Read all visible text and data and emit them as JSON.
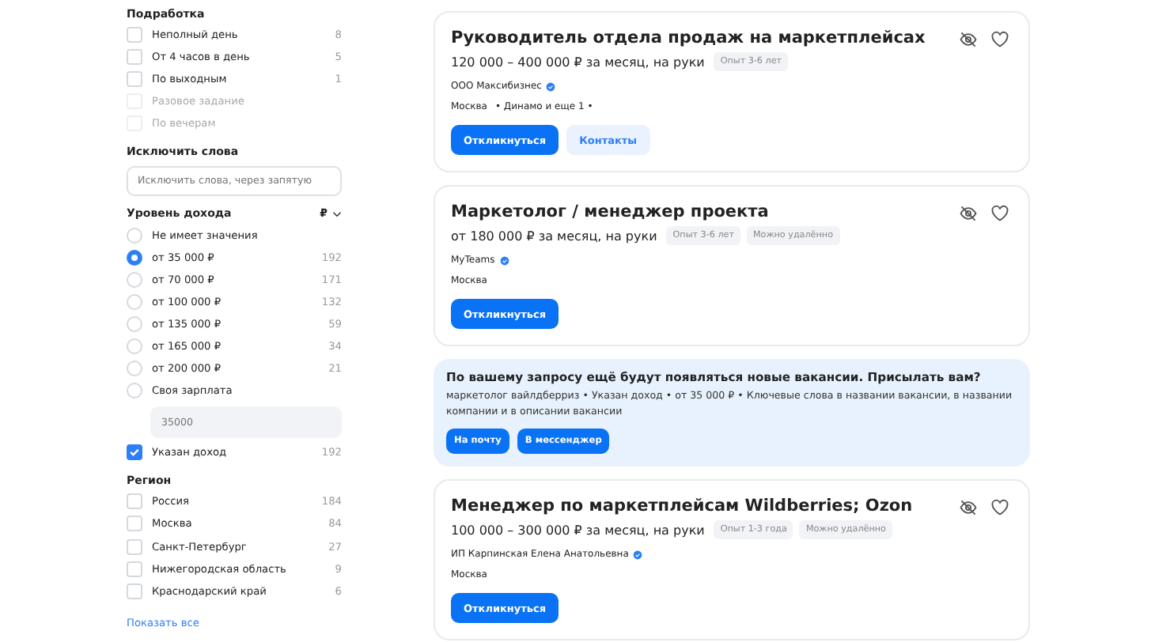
{
  "sidebar": {
    "part_time": {
      "title": "Подработка",
      "items": [
        {
          "label": "Неполный день",
          "count": "8",
          "checked": false,
          "disabled": false
        },
        {
          "label": "От 4 часов в день",
          "count": "5",
          "checked": false,
          "disabled": false
        },
        {
          "label": "По выходным",
          "count": "1",
          "checked": false,
          "disabled": false
        },
        {
          "label": "Разовое задание",
          "checked": false,
          "disabled": true
        },
        {
          "label": "По вечерам",
          "checked": false,
          "disabled": true
        }
      ]
    },
    "exclude": {
      "title": "Исключить слова",
      "placeholder": "Исключить слова, через запятую"
    },
    "income": {
      "title": "Уровень дохода",
      "currency": "₽",
      "options": [
        {
          "label": "Не имеет значения",
          "selected": false
        },
        {
          "label": "от 35 000 ₽",
          "count": "192",
          "selected": true
        },
        {
          "label": "от 70 000 ₽",
          "count": "171",
          "selected": false
        },
        {
          "label": "от 100 000 ₽",
          "count": "132",
          "selected": false
        },
        {
          "label": "от 135 000 ₽",
          "count": "59",
          "selected": false
        },
        {
          "label": "от 165 000 ₽",
          "count": "34",
          "selected": false
        },
        {
          "label": "от 200 000 ₽",
          "count": "21",
          "selected": false
        },
        {
          "label": "Своя зарплата",
          "selected": false
        }
      ],
      "custom_placeholder": "35000",
      "with_income": {
        "label": "Указан доход",
        "count": "192",
        "checked": true
      }
    },
    "region": {
      "title": "Регион",
      "items": [
        {
          "label": "Россия",
          "count": "184",
          "checked": false
        },
        {
          "label": "Москва",
          "count": "84",
          "checked": false
        },
        {
          "label": "Санкт-Петербург",
          "count": "27",
          "checked": false
        },
        {
          "label": "Нижегородская область",
          "count": "9",
          "checked": false
        },
        {
          "label": "Краснодарский край",
          "count": "6",
          "checked": false
        }
      ],
      "show_all": "Показать все"
    }
  },
  "feed": [
    {
      "kind": "vacancy",
      "title": "Руководитель отдела продаж на маркетплейсах",
      "salary": "120 000 – 400 000 ₽ за месяц, на руки",
      "tags": [
        "Опыт 3-6 лет"
      ],
      "company": "ООО Максибизнес",
      "verified": true,
      "location": "Москва",
      "metro": "• Динамо и еще 1 •",
      "buttons": [
        {
          "label": "Откликнуться",
          "kind": "primary"
        },
        {
          "label": "Контакты",
          "kind": "secondary"
        }
      ]
    },
    {
      "kind": "vacancy",
      "title": "Маркетолог / менеджер проекта",
      "salary": "от 180 000 ₽ за месяц, на руки",
      "tags": [
        "Опыт 3-6 лет",
        "Можно удалённо"
      ],
      "company": "MyTeams",
      "verified": true,
      "location": "Москва",
      "buttons": [
        {
          "label": "Откликнуться",
          "kind": "primary"
        }
      ]
    },
    {
      "kind": "subscribe",
      "title": "По вашему запросу ещё будут появляться новые вакансии. Присылать вам?",
      "text": "маркетолог вайлдберриз • Указан доход • от 35 000 ₽ • Ключевые слова в названии вакансии, в названии компании и в описании вакансии",
      "buttons": [
        "На почту",
        "В мессенджер"
      ]
    },
    {
      "kind": "vacancy",
      "title": "Менеджер по маркетплейсам Wildberries; Ozon",
      "salary": "100 000 – 300 000 ₽ за месяц, на руки",
      "tags": [
        "Опыт 1-3 года",
        "Можно удалённо"
      ],
      "company": "ИП Карпинская Елена Анатольевна",
      "verified": true,
      "location": "Москва",
      "buttons": [
        {
          "label": "Откликнуться",
          "kind": "primary"
        }
      ]
    }
  ]
}
